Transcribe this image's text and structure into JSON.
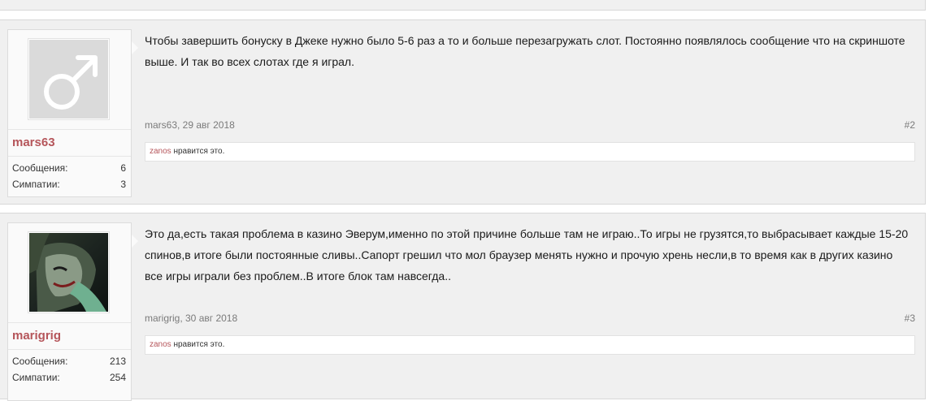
{
  "posts": [
    {
      "username": "mars63",
      "avatar": "male-symbol-icon",
      "stats": [
        {
          "label": "Сообщения:",
          "value": "6"
        },
        {
          "label": "Симпатии:",
          "value": "3"
        }
      ],
      "message": "Чтобы завершить бонуску в Джеке нужно было 5-6 раз а то и больше перезагружать слот. Постоянно появлялось сообщение что на скриншоте выше. И так во всех слотах где я играл.",
      "meta": "mars63, 29 авг 2018",
      "post_number": "#2",
      "likes": {
        "user": "zanos",
        "text": " нравится это."
      }
    },
    {
      "username": "marigrig",
      "avatar": "joker-avatar",
      "stats": [
        {
          "label": "Сообщения:",
          "value": "213"
        },
        {
          "label": "Симпатии:",
          "value": "254"
        }
      ],
      "message": "Это да,есть такая проблема в казино Эверум,именно по этой причине больше там не играю..То игры не грузятся,то выбрасывает каждые 15-20 спинов,в итоге были постоянные сливы..Сапорт грешил что мол браузер менять нужно и прочую хрень несли,в то время как в других казино все игры играли без проблем..В итоге блок там навсегда..",
      "meta": "marigrig, 30 авг 2018",
      "post_number": "#3",
      "likes": {
        "user": "zanos",
        "text": " нравится это."
      }
    }
  ],
  "colors": {
    "username": "#b5555a",
    "post_bg": "#f0f0f0",
    "user_box_bg": "#fafafa"
  }
}
